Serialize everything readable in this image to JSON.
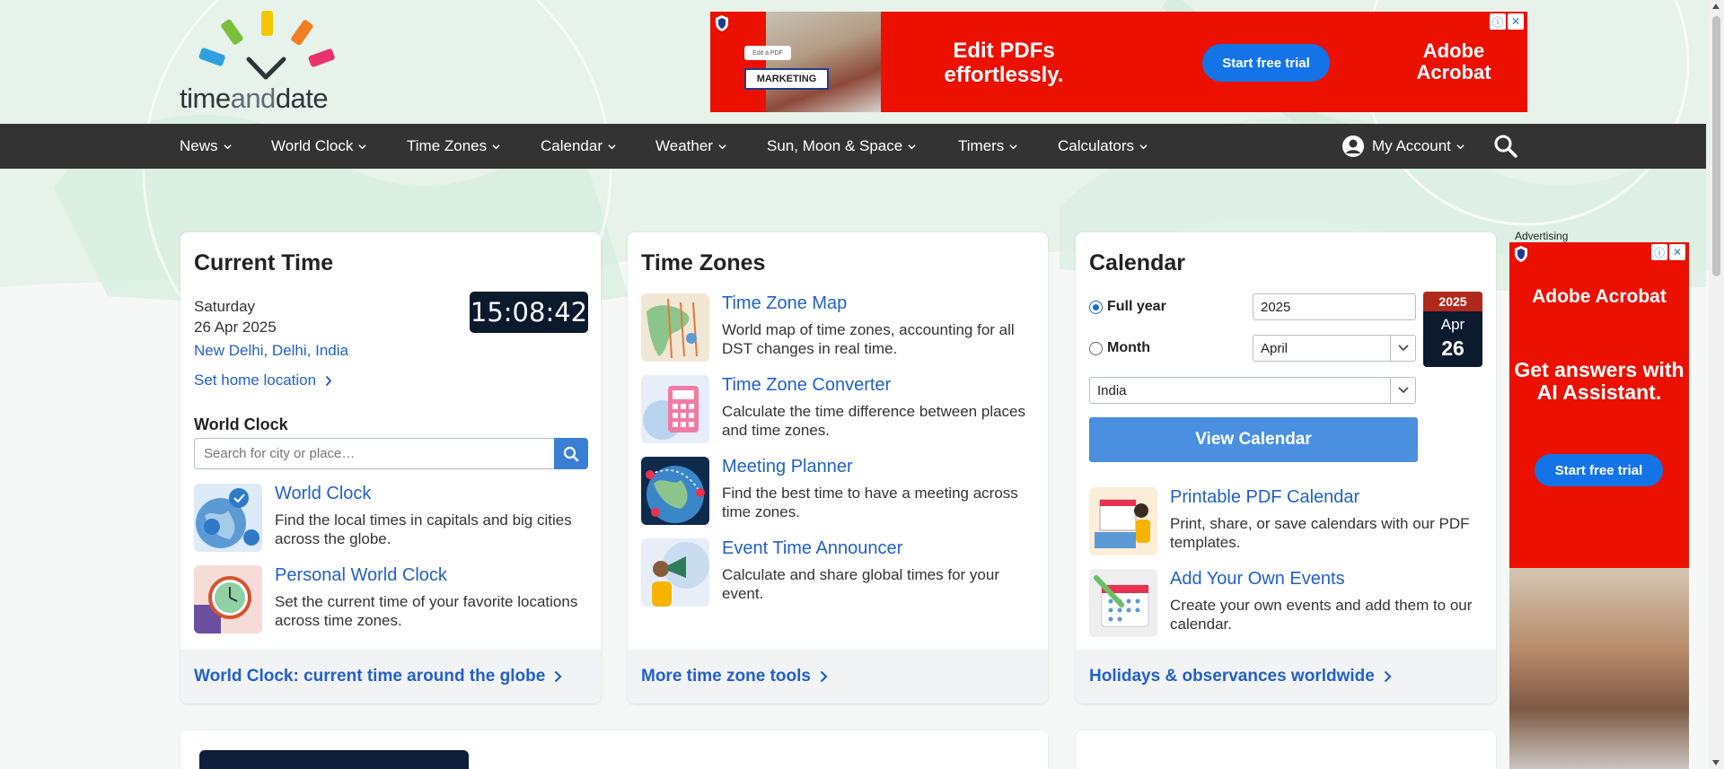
{
  "brand": {
    "logo_text_a": "time",
    "logo_text_b": "and",
    "logo_text_c": "date"
  },
  "top_ad": {
    "chip": "Edit a PDF",
    "tag": "MARKETING",
    "headline": "Edit PDFs effortlessly.",
    "cta": "Start free trial",
    "brand": "Adobe Acrobat",
    "info": "ⓘ",
    "close": "✕"
  },
  "nav": {
    "items": [
      {
        "label": "News"
      },
      {
        "label": "World Clock"
      },
      {
        "label": "Time Zones"
      },
      {
        "label": "Calendar"
      },
      {
        "label": "Weather"
      },
      {
        "label": "Sun, Moon & Space"
      },
      {
        "label": "Timers"
      },
      {
        "label": "Calculators"
      }
    ],
    "account": "My Account"
  },
  "current_time": {
    "title": "Current Time",
    "day": "Saturday",
    "date": "26 Apr 2025",
    "location": "New Delhi, Delhi, India",
    "set_home": "Set home location",
    "clock": "15:08:42",
    "world_clock_label": "World Clock",
    "search_placeholder": "Search for city or place…",
    "tools": [
      {
        "title": "World Clock",
        "desc": "Find the local times in capitals and big cities across the globe."
      },
      {
        "title": "Personal World Clock",
        "desc": "Set the current time of your favorite locations across time zones."
      }
    ],
    "footer": "World Clock: current time around the globe"
  },
  "time_zones": {
    "title": "Time Zones",
    "tools": [
      {
        "title": "Time Zone Map",
        "desc": "World map of time zones, accounting for all DST changes in real time."
      },
      {
        "title": "Time Zone Converter",
        "desc": "Calculate the time difference between places and time zones."
      },
      {
        "title": "Meeting Planner",
        "desc": "Find the best time to have a meeting across time zones."
      },
      {
        "title": "Event Time Announcer",
        "desc": "Calculate and share global times for your event."
      }
    ],
    "footer": "More time zone tools"
  },
  "calendar": {
    "title": "Calendar",
    "full_year_label": "Full year",
    "month_label": "Month",
    "year_value": "2025",
    "month_value": "April",
    "country_value": "India",
    "icon_year": "2025",
    "icon_month": "Apr",
    "icon_day": "26",
    "view_button": "View Calendar",
    "tools": [
      {
        "title": "Printable PDF Calendar",
        "desc": "Print, share, or save calendars with our PDF templates."
      },
      {
        "title": "Add Your Own Events",
        "desc": "Create your own events and add them to our calendar."
      }
    ],
    "footer": "Holidays & observances worldwide"
  },
  "side_ad": {
    "label": "Advertising",
    "brand": "Adobe Acrobat",
    "headline": "Get answers with AI Assistant.",
    "cta": "Start free trial",
    "info": "ⓘ",
    "close": "✕"
  },
  "colors": {
    "nav_bg": "#333333",
    "link": "#2360c4",
    "ad_red": "#eb1000",
    "ad_blue": "#1473e6",
    "clock_bg": "#0c1a2e",
    "button_blue": "#4a8fe0"
  }
}
